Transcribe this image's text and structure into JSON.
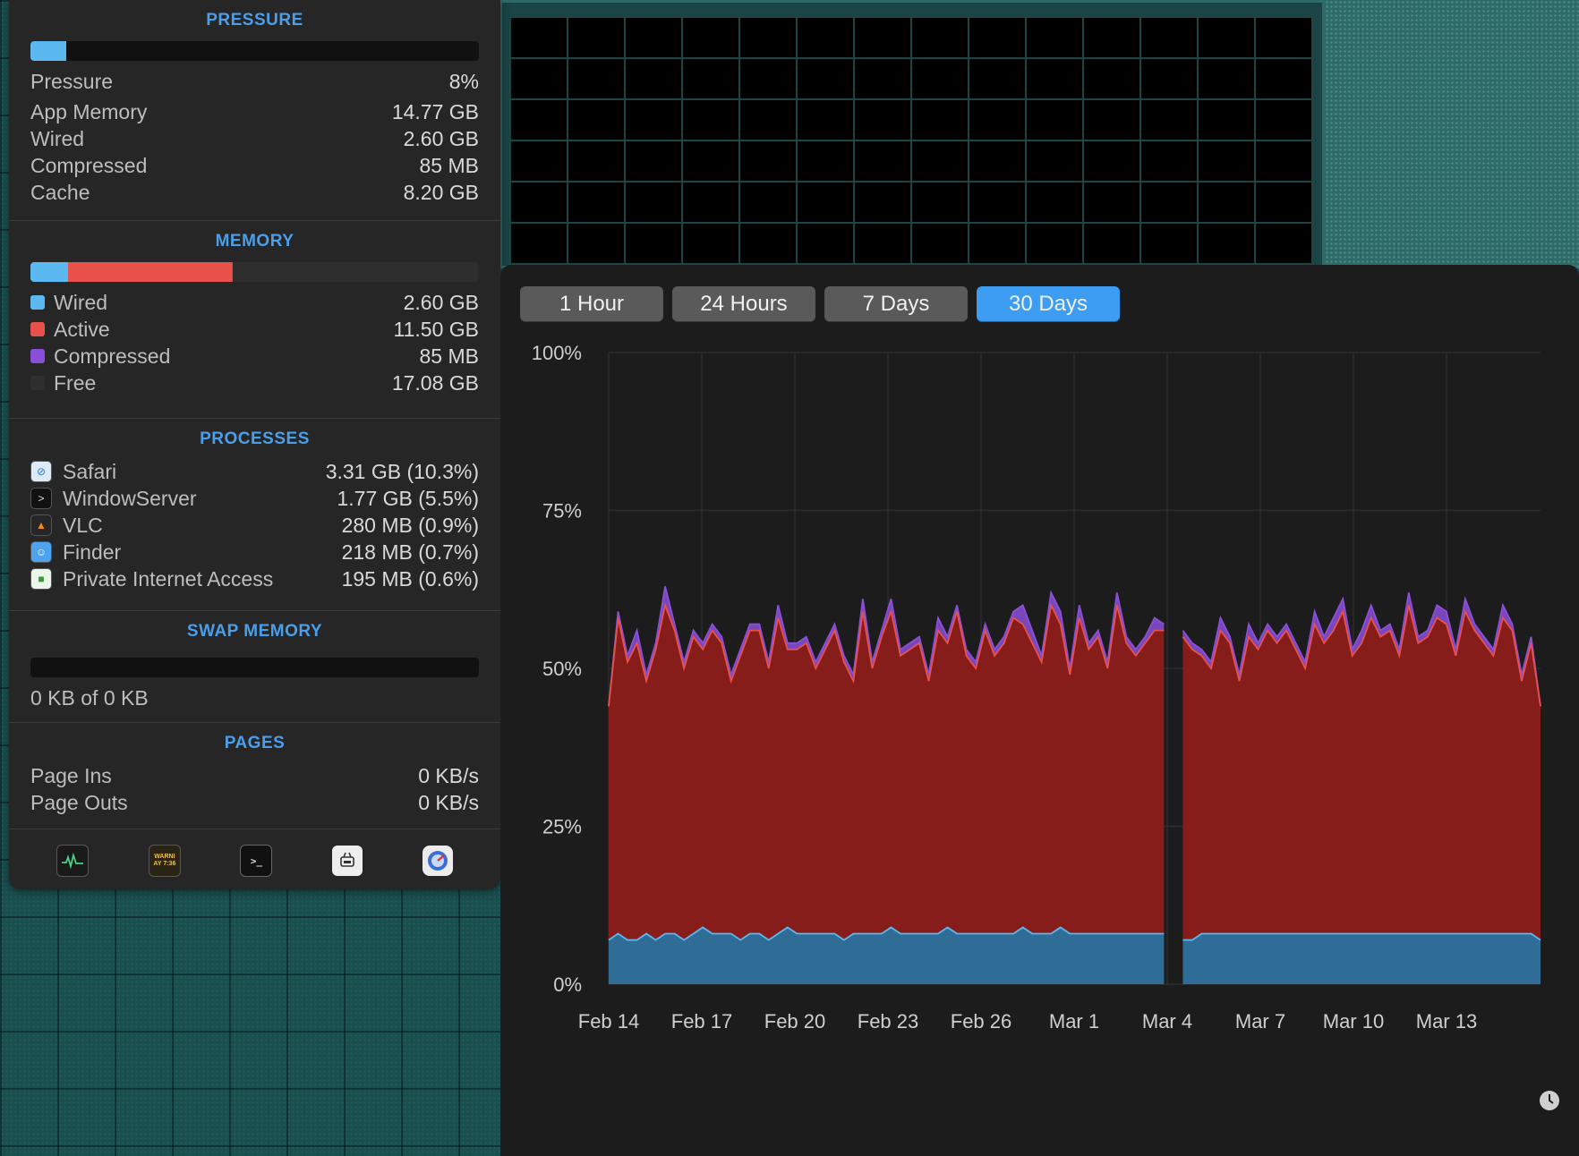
{
  "pressure": {
    "title": "PRESSURE",
    "fraction": 0.08,
    "rows": [
      {
        "label": "Pressure",
        "value": "8%"
      },
      {
        "label": "App Memory",
        "value": "14.77 GB"
      },
      {
        "label": "Wired",
        "value": "2.60 GB"
      },
      {
        "label": "Compressed",
        "value": "85 MB"
      },
      {
        "label": "Cache",
        "value": "8.20 GB"
      }
    ]
  },
  "memory": {
    "title": "MEMORY",
    "segments": [
      {
        "label": "Wired",
        "value": "2.60 GB",
        "color": "#5bb8f0",
        "fraction": 0.083
      },
      {
        "label": "Active",
        "value": "11.50 GB",
        "color": "#e8504a",
        "fraction": 0.366
      },
      {
        "label": "Compressed",
        "value": "85 MB",
        "color": "#8a4fd8",
        "fraction": 0.003
      },
      {
        "label": "Free",
        "value": "17.08 GB",
        "color": "#2e2e2e",
        "fraction": 0.548
      }
    ]
  },
  "processes": {
    "title": "PROCESSES",
    "items": [
      {
        "name": "Safari",
        "value": "3.31 GB (10.3%)",
        "icon": "safari-icon"
      },
      {
        "name": "WindowServer",
        "value": "1.77 GB (5.5%)",
        "icon": "terminal-icon"
      },
      {
        "name": "VLC",
        "value": "280 MB (0.9%)",
        "icon": "vlc-cone-icon"
      },
      {
        "name": "Finder",
        "value": "218 MB (0.7%)",
        "icon": "finder-icon"
      },
      {
        "name": "Private Internet Access",
        "value": "195 MB (0.6%)",
        "icon": "lock-icon"
      }
    ]
  },
  "swap": {
    "title": "SWAP MEMORY",
    "fraction": 0,
    "text": "0 KB of 0 KB"
  },
  "pages": {
    "title": "PAGES",
    "rows": [
      {
        "label": "Page Ins",
        "value": "0 KB/s"
      },
      {
        "label": "Page Outs",
        "value": "0 KB/s"
      }
    ]
  },
  "footer": {
    "icons": [
      "activity-monitor-icon",
      "console-icon",
      "terminal-icon",
      "system-info-icon",
      "disk-utility-icon"
    ],
    "console_text": "WARNI\nAY 7:36"
  },
  "time_ranges": {
    "options": [
      "1 Hour",
      "24 Hours",
      "7 Days",
      "30 Days"
    ],
    "selected": "30 Days"
  },
  "chart_data": {
    "type": "area",
    "y_ticks": [
      "100%",
      "75%",
      "50%",
      "25%",
      "0%"
    ],
    "x_ticks": [
      "Feb 14",
      "Feb 17",
      "Feb 20",
      "Feb 23",
      "Feb 26",
      "Mar 1",
      "Mar 4",
      "Mar 7",
      "Mar 10",
      "Mar 13"
    ],
    "ylim": [
      0,
      100
    ],
    "grid": true,
    "colors": {
      "wired": "#2f6d97",
      "wired_line": "#5bb8f0",
      "active": "#861d1a",
      "active_line": "#e8504a",
      "compressed": "#8a4fd8"
    },
    "series": [
      {
        "key": "wired",
        "values": [
          7,
          8,
          7,
          7,
          8,
          7,
          8,
          8,
          7,
          8,
          9,
          8,
          8,
          8,
          7,
          8,
          8,
          7,
          8,
          9,
          8,
          8,
          8,
          8,
          8,
          7,
          8,
          8,
          8,
          8,
          9,
          8,
          8,
          8,
          8,
          8,
          9,
          8,
          8,
          8,
          8,
          8,
          8,
          8,
          9,
          8,
          8,
          8,
          9,
          8,
          8,
          8,
          8,
          8,
          8,
          8,
          8,
          8,
          8,
          8,
          0,
          7,
          7,
          8,
          8,
          8,
          8,
          8,
          8,
          8,
          8,
          8,
          8,
          8,
          8,
          8,
          8,
          8,
          8,
          8,
          8,
          8,
          8,
          8,
          8,
          8,
          8,
          8,
          8,
          8,
          8,
          8,
          8,
          8,
          8,
          8,
          8,
          8,
          8,
          7
        ]
      },
      {
        "key": "active",
        "values": [
          37,
          50,
          44,
          47,
          40,
          46,
          52,
          48,
          43,
          47,
          44,
          48,
          46,
          40,
          45,
          48,
          48,
          43,
          50,
          44,
          45,
          46,
          42,
          45,
          48,
          44,
          40,
          51,
          42,
          47,
          50,
          44,
          45,
          46,
          40,
          48,
          45,
          51,
          44,
          42,
          48,
          44,
          46,
          50,
          48,
          46,
          43,
          52,
          48,
          41,
          50,
          45,
          47,
          42,
          52,
          46,
          44,
          46,
          48,
          48,
          0,
          48,
          46,
          44,
          42,
          48,
          46,
          40,
          47,
          45,
          48,
          46,
          48,
          45,
          42,
          49,
          46,
          48,
          51,
          44,
          46,
          50,
          47,
          48,
          44,
          52,
          46,
          47,
          50,
          49,
          44,
          51,
          48,
          46,
          44,
          50,
          48,
          40,
          46,
          37
        ]
      },
      {
        "key": "compressed",
        "values": [
          0,
          1,
          1,
          2,
          1,
          1,
          3,
          1,
          1,
          1,
          1,
          1,
          1,
          1,
          1,
          1,
          1,
          1,
          2,
          1,
          1,
          1,
          1,
          1,
          1,
          1,
          1,
          2,
          1,
          1,
          2,
          1,
          1,
          1,
          1,
          2,
          1,
          1,
          1,
          1,
          1,
          1,
          1,
          1,
          3,
          2,
          1,
          2,
          2,
          1,
          2,
          1,
          1,
          1,
          2,
          1,
          1,
          1,
          2,
          1,
          0,
          1,
          1,
          1,
          1,
          2,
          1,
          1,
          2,
          1,
          1,
          1,
          1,
          1,
          1,
          2,
          1,
          2,
          2,
          1,
          2,
          2,
          1,
          1,
          1,
          2,
          1,
          1,
          2,
          2,
          1,
          2,
          1,
          1,
          1,
          2,
          1,
          1,
          1,
          0
        ]
      }
    ]
  }
}
